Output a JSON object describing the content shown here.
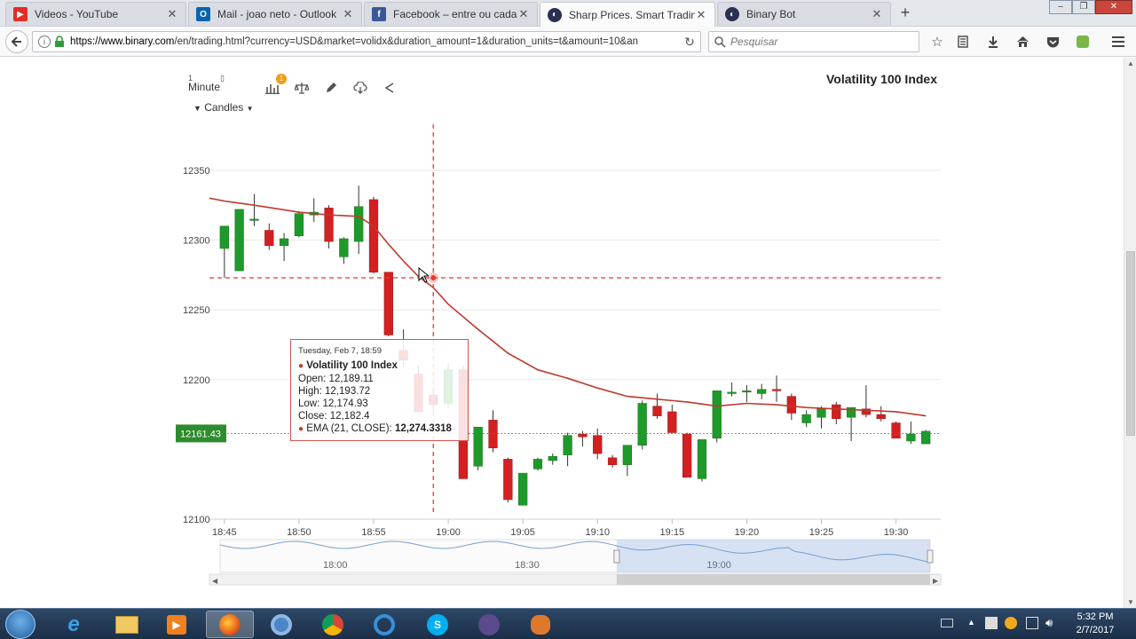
{
  "browser": {
    "tabs": [
      {
        "label": "Videos - YouTube",
        "icon": "youtube-icon",
        "color": "#e52d27"
      },
      {
        "label": "Mail - joao neto - Outlook",
        "icon": "outlook-icon",
        "color": "#0a64ad"
      },
      {
        "label": "Facebook – entre ou cadas...",
        "icon": "facebook-icon",
        "color": "#3b5998"
      },
      {
        "label": "Sharp Prices. Smart Tradin...",
        "icon": "binary-icon",
        "color": "#2a3052"
      },
      {
        "label": "Binary Bot",
        "icon": "binary-icon",
        "color": "#2a3052"
      }
    ],
    "url_host": "https://www.binary.com",
    "url_path": "/en/trading.html?currency=USD&market=volidx&duration_amount=1&duration_units=t&amount=10&an",
    "search_placeholder": "Pesquisar"
  },
  "chart_toolbar": {
    "interval_number": "1",
    "interval_unit": "Minute",
    "chart_type": "Candles",
    "indicator_badge": "1"
  },
  "chart_data": {
    "type": "candlestick",
    "title": "Volatility 100 Index",
    "ylim": [
      12100,
      12383
    ],
    "y_ticks": [
      12100,
      12200,
      12250,
      12300,
      12350
    ],
    "y_tick_labels": [
      "12100",
      "12200",
      "12250",
      "12300",
      "12350"
    ],
    "x_time_range": [
      "18:44",
      "19:33"
    ],
    "x_ticks": [
      "18:45",
      "18:50",
      "18:55",
      "19:00",
      "19:05",
      "19:10",
      "19:15",
      "19:20",
      "19:25",
      "19:30"
    ],
    "current_price": "12161.43",
    "current_price_value": 12161.43,
    "crosshair": {
      "time": "18:59",
      "price": 12273
    },
    "series_name": "EMA (21, CLOSE)",
    "colors": {
      "up": "#1e9a2a",
      "down": "#d32020",
      "ema": "#c0392b",
      "price_tag": "#2e8b2e"
    },
    "candles": [
      {
        "t": "18:45",
        "o": 12294,
        "h": 12310,
        "l": 12273,
        "c": 12310
      },
      {
        "t": "18:46",
        "o": 12278,
        "h": 12322,
        "l": 12278,
        "c": 12322
      },
      {
        "t": "18:47",
        "o": 12315,
        "h": 12333,
        "l": 12310,
        "c": 12315
      },
      {
        "t": "18:48",
        "o": 12307,
        "h": 12312,
        "l": 12293,
        "c": 12296
      },
      {
        "t": "18:49",
        "o": 12296,
        "h": 12305,
        "l": 12285,
        "c": 12301
      },
      {
        "t": "18:50",
        "o": 12303,
        "h": 12320,
        "l": 12302,
        "c": 12319
      },
      {
        "t": "18:51",
        "o": 12318,
        "h": 12330,
        "l": 12313,
        "c": 12320
      },
      {
        "t": "18:52",
        "o": 12323,
        "h": 12325,
        "l": 12294,
        "c": 12299
      },
      {
        "t": "18:53",
        "o": 12288,
        "h": 12302,
        "l": 12283,
        "c": 12301
      },
      {
        "t": "18:54",
        "o": 12299,
        "h": 12339,
        "l": 12290,
        "c": 12324
      },
      {
        "t": "18:55",
        "o": 12329,
        "h": 12331,
        "l": 12276,
        "c": 12277
      },
      {
        "t": "18:56",
        "o": 12277,
        "h": 12277,
        "l": 12231,
        "c": 12232
      },
      {
        "t": "18:57",
        "o": 12221,
        "h": 12236,
        "l": 12209,
        "c": 12214
      },
      {
        "t": "18:58",
        "o": 12204,
        "h": 12210,
        "l": 12176,
        "c": 12177
      },
      {
        "t": "18:59",
        "o": 12189,
        "h": 12194,
        "l": 12175,
        "c": 12182
      },
      {
        "t": "19:00",
        "o": 12183,
        "h": 12212,
        "l": 12180,
        "c": 12207
      },
      {
        "t": "19:01",
        "o": 12207,
        "h": 12210,
        "l": 12129,
        "c": 12129
      },
      {
        "t": "19:02",
        "o": 12138,
        "h": 12166,
        "l": 12135,
        "c": 12166
      },
      {
        "t": "19:03",
        "o": 12171,
        "h": 12178,
        "l": 12148,
        "c": 12151
      },
      {
        "t": "19:04",
        "o": 12143,
        "h": 12144,
        "l": 12112,
        "c": 12114
      },
      {
        "t": "19:05",
        "o": 12110,
        "h": 12133,
        "l": 12110,
        "c": 12133
      },
      {
        "t": "19:06",
        "o": 12136,
        "h": 12144,
        "l": 12135,
        "c": 12143
      },
      {
        "t": "19:07",
        "o": 12142,
        "h": 12147,
        "l": 12139,
        "c": 12145
      },
      {
        "t": "19:08",
        "o": 12146,
        "h": 12162,
        "l": 12138,
        "c": 12160
      },
      {
        "t": "19:09",
        "o": 12161,
        "h": 12163,
        "l": 12152,
        "c": 12159
      },
      {
        "t": "19:10",
        "o": 12160,
        "h": 12165,
        "l": 12143,
        "c": 12147
      },
      {
        "t": "19:11",
        "o": 12144,
        "h": 12146,
        "l": 12137,
        "c": 12139
      },
      {
        "t": "19:12",
        "o": 12139,
        "h": 12153,
        "l": 12131,
        "c": 12153
      },
      {
        "t": "19:13",
        "o": 12153,
        "h": 12185,
        "l": 12150,
        "c": 12183
      },
      {
        "t": "19:14",
        "o": 12181,
        "h": 12190,
        "l": 12172,
        "c": 12174
      },
      {
        "t": "19:15",
        "o": 12177,
        "h": 12182,
        "l": 12162,
        "c": 12162
      },
      {
        "t": "19:16",
        "o": 12161,
        "h": 12162,
        "l": 12130,
        "c": 12130
      },
      {
        "t": "19:17",
        "o": 12129,
        "h": 12157,
        "l": 12127,
        "c": 12157
      },
      {
        "t": "19:18",
        "o": 12158,
        "h": 12192,
        "l": 12155,
        "c": 12192
      },
      {
        "t": "19:19",
        "o": 12190,
        "h": 12198,
        "l": 12188,
        "c": 12191
      },
      {
        "t": "19:20",
        "o": 12192,
        "h": 12196,
        "l": 12184,
        "c": 12192
      },
      {
        "t": "19:21",
        "o": 12190,
        "h": 12197,
        "l": 12186,
        "c": 12193
      },
      {
        "t": "19:22",
        "o": 12193,
        "h": 12203,
        "l": 12184,
        "c": 12192
      },
      {
        "t": "19:23",
        "o": 12188,
        "h": 12190,
        "l": 12171,
        "c": 12176
      },
      {
        "t": "19:24",
        "o": 12169,
        "h": 12178,
        "l": 12166,
        "c": 12175
      },
      {
        "t": "19:25",
        "o": 12173,
        "h": 12181,
        "l": 12165,
        "c": 12179
      },
      {
        "t": "19:26",
        "o": 12182,
        "h": 12184,
        "l": 12168,
        "c": 12172
      },
      {
        "t": "19:27",
        "o": 12173,
        "h": 12180,
        "l": 12156,
        "c": 12180
      },
      {
        "t": "19:28",
        "o": 12179,
        "h": 12196,
        "l": 12173,
        "c": 12175
      },
      {
        "t": "19:29",
        "o": 12175,
        "h": 12181,
        "l": 12170,
        "c": 12172
      },
      {
        "t": "19:30",
        "o": 12169,
        "h": 12170,
        "l": 12158,
        "c": 12158
      },
      {
        "t": "19:31",
        "o": 12156,
        "h": 12170,
        "l": 12154,
        "c": 12161
      },
      {
        "t": "19:32",
        "o": 12154,
        "h": 12164,
        "l": 12154,
        "c": 12163
      }
    ],
    "ema": [
      {
        "t": "18:44",
        "v": 12330
      },
      {
        "t": "18:45",
        "v": 12328
      },
      {
        "t": "18:47",
        "v": 12325
      },
      {
        "t": "18:50",
        "v": 12320
      },
      {
        "t": "18:52",
        "v": 12318
      },
      {
        "t": "18:54",
        "v": 12317
      },
      {
        "t": "18:55",
        "v": 12310
      },
      {
        "t": "18:56",
        "v": 12297
      },
      {
        "t": "18:57",
        "v": 12285
      },
      {
        "t": "18:58",
        "v": 12274
      },
      {
        "t": "18:59",
        "v": 12266
      },
      {
        "t": "19:00",
        "v": 12254
      },
      {
        "t": "19:02",
        "v": 12236
      },
      {
        "t": "19:04",
        "v": 12219
      },
      {
        "t": "19:06",
        "v": 12207
      },
      {
        "t": "19:08",
        "v": 12201
      },
      {
        "t": "19:10",
        "v": 12194
      },
      {
        "t": "19:12",
        "v": 12188
      },
      {
        "t": "19:14",
        "v": 12186
      },
      {
        "t": "19:16",
        "v": 12184
      },
      {
        "t": "19:18",
        "v": 12181
      },
      {
        "t": "19:20",
        "v": 12183
      },
      {
        "t": "19:22",
        "v": 12182
      },
      {
        "t": "19:24",
        "v": 12180
      },
      {
        "t": "19:26",
        "v": 12179
      },
      {
        "t": "19:28",
        "v": 12178
      },
      {
        "t": "19:30",
        "v": 12177
      },
      {
        "t": "19:32",
        "v": 12174
      }
    ],
    "tooltip": {
      "date": "Tuesday, Feb 7, 18:59",
      "series": "Volatility 100 Index",
      "open": "Open: 12,189.11",
      "high": "High: 12,193.72",
      "low": "Low: 12,174.93",
      "close": "Close: 12,182.4",
      "ema_label": "EMA (21, CLOSE):",
      "ema_value": "12,274.3318"
    },
    "navigator": {
      "labels": [
        "18:00",
        "18:30",
        "19:00"
      ],
      "selected_range": [
        "18:44",
        "19:33"
      ]
    }
  },
  "taskbar": {
    "apps": [
      "start-orb",
      "internet-explorer-icon",
      "file-explorer-icon",
      "media-player-icon",
      "firefox-icon",
      "chromium-icon",
      "chrome-icon",
      "ccleaner-icon",
      "skype-icon",
      "app-icon",
      "mitt-icon"
    ],
    "time": "5:32 PM",
    "date": "2/7/2017"
  }
}
